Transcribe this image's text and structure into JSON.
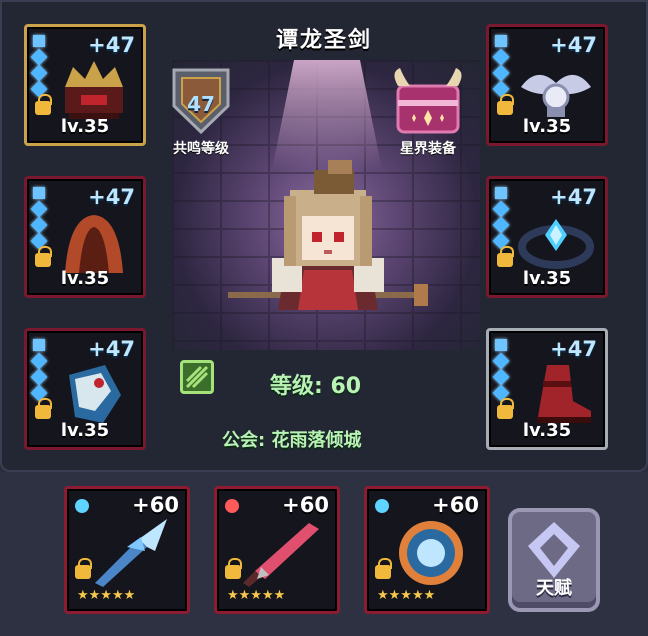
{
  "hero": {
    "name": "谭龙圣剑",
    "level_text": "等级: 60",
    "guild_text": "公会: 花雨落倾城"
  },
  "badges": {
    "resonance": {
      "value": "47",
      "label": "共鸣等级"
    },
    "astral": {
      "label": "星界装备"
    }
  },
  "equipment_left": [
    {
      "plus": "+47",
      "level": "lv.35",
      "icon": "dark-crown-helmet-icon"
    },
    {
      "plus": "+47",
      "level": "lv.35",
      "icon": "red-cloak-icon"
    },
    {
      "plus": "+47",
      "level": "lv.35",
      "icon": "ice-gauntlet-icon"
    }
  ],
  "equipment_right": [
    {
      "plus": "+47",
      "level": "lv.35",
      "icon": "silver-winged-amulet-icon"
    },
    {
      "plus": "+47",
      "level": "lv.35",
      "icon": "blue-gem-ring-icon"
    },
    {
      "plus": "+47",
      "level": "lv.35",
      "icon": "red-boots-icon"
    }
  ],
  "weapons": [
    {
      "plus": "+60",
      "stars": "★★★★★",
      "icon": "ice-spear-icon",
      "rune_color": "#5fd4ff"
    },
    {
      "plus": "+60",
      "stars": "★★★★★",
      "icon": "crimson-sword-icon",
      "rune_color": "#ff5a5a"
    },
    {
      "plus": "+60",
      "stars": "★★★★★",
      "icon": "crystal-shield-icon",
      "rune_color": "#5fd4ff"
    }
  ],
  "talent_button": {
    "label": "天赋"
  },
  "colors": {
    "slot_border": "#7a1830",
    "accent_green": "#b9f3b4",
    "plus_blue": "#bde6ff"
  }
}
